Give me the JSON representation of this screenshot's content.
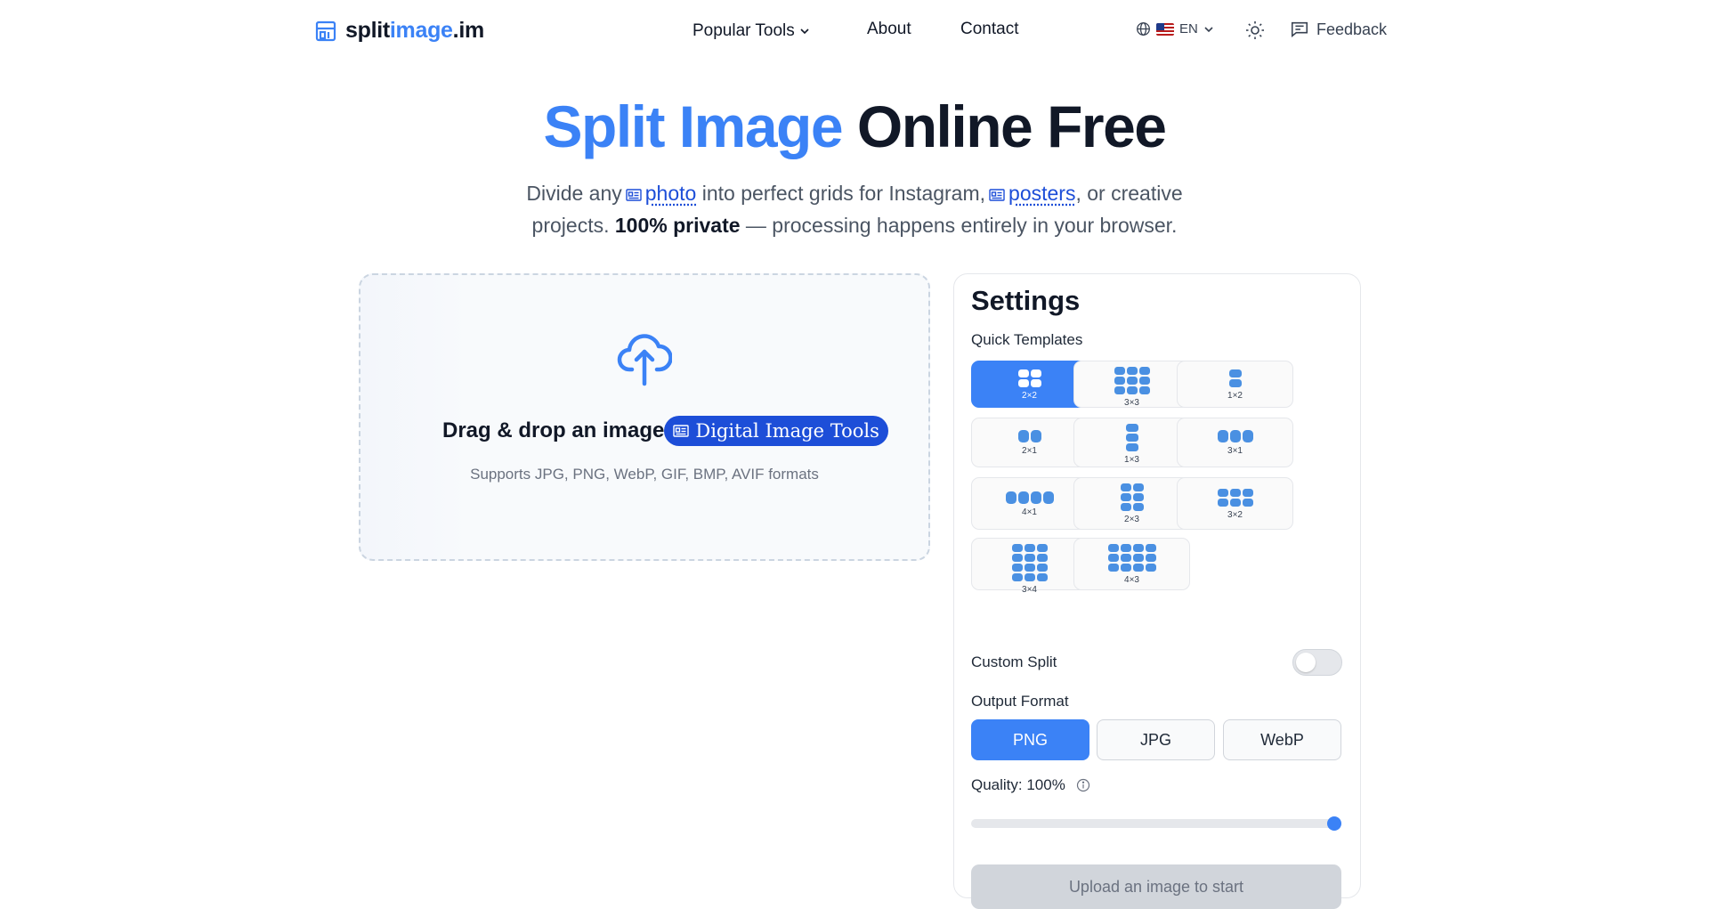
{
  "nav": {
    "logo": {
      "part1": "split",
      "part2": "image",
      "part3": ".im"
    },
    "links": {
      "popular_tools": "Popular Tools",
      "about": "About",
      "contact": "Contact"
    },
    "language": "EN",
    "feedback": "Feedback"
  },
  "hero": {
    "title_blue": "Split Image",
    "title_dark": "Online Free",
    "subtitle": {
      "t1": "Divide any",
      "link1": "photo",
      "t2": "into perfect grids for Instagram,",
      "link2": "posters",
      "t3": ", or creative projects.",
      "bold": "100% private",
      "t4": "— processing happens entirely in your browser."
    }
  },
  "upload": {
    "title": "Drag & drop an image",
    "badge": "Digital Image Tools",
    "formats": "Supports JPG, PNG, WebP, GIF, BMP, AVIF formats"
  },
  "settings": {
    "title": "Settings",
    "quick_templates_label": "Quick Templates",
    "templates": [
      "2×2",
      "3×3",
      "1×2",
      "2×1",
      "1×3",
      "3×1",
      "4×1",
      "2×3",
      "3×2",
      "3×4",
      "4×3"
    ],
    "active_template": "2×2",
    "custom_split_label": "Custom Split",
    "custom_split_enabled": false,
    "output_format_label": "Output Format",
    "formats": [
      "PNG",
      "JPG",
      "WebP"
    ],
    "active_format": "PNG",
    "quality_label": "Quality: 100%",
    "quality_value": 100,
    "upload_button": "Upload an image to start"
  },
  "colors": {
    "accent": "#3b82f6",
    "badge": "#1d4ed8",
    "text": "#111827"
  }
}
